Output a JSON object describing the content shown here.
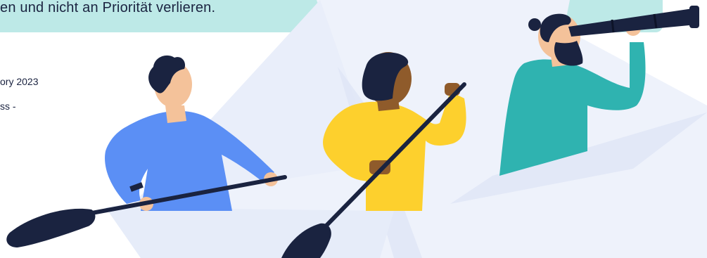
{
  "banner": {
    "text": "en und nicht an Priorität verlieren."
  },
  "meta": {
    "date_fragment": "ory 2023",
    "category_fragment": "ss -"
  },
  "colors": {
    "banner_bg": "#bde9e7",
    "boat": "#eef2fb",
    "boat_shadow": "#dde4f5",
    "navy": "#1a2340",
    "blue_shirt": "#5b8ff5",
    "yellow_shirt": "#fdd02d",
    "teal_shirt": "#2fb3b0",
    "skin_light": "#f4c29a",
    "skin_brown": "#8f5b2b"
  },
  "icons": {
    "illustration": "rowing-team-paper-boat-illustration"
  }
}
